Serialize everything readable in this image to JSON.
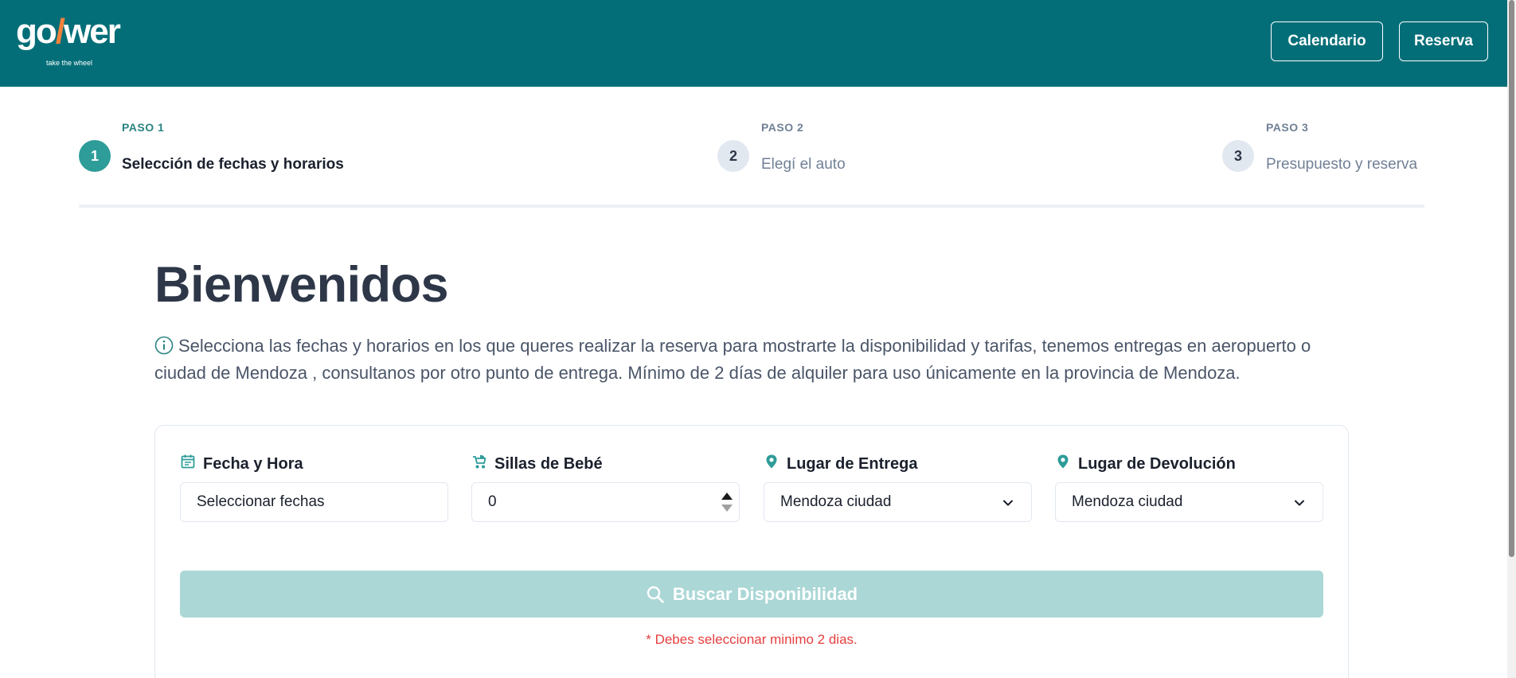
{
  "header": {
    "logo_text_a": "go",
    "logo_text_slash": "/",
    "logo_text_b": "wer",
    "logo_tagline": "take the wheel",
    "nav_calendar": "Calendario",
    "nav_reserve": "Reserva",
    "colors": {
      "bar": "#036e78",
      "accent": "#f0823c"
    }
  },
  "stepper": {
    "steps": [
      {
        "number": "1",
        "kicker": "PASO 1",
        "title": "Selección de fechas y horarios",
        "active": true
      },
      {
        "number": "2",
        "kicker": "PASO 2",
        "title": "Elegí el auto",
        "active": false
      },
      {
        "number": "3",
        "kicker": "PASO 3",
        "title": "Presupuesto y reserva",
        "active": false
      }
    ]
  },
  "main": {
    "title": "Bienvenidos",
    "info_icon": "info-icon",
    "info_text": "Selecciona las fechas y horarios en los que queres realizar la reserva para mostrarte la disponibilidad y tarifas, tenemos entregas en aeropuerto o ciudad de Mendoza , consultanos por otro punto de entrega. Mínimo de 2 días de alquiler para uso únicamente en la provincia de Mendoza."
  },
  "form": {
    "date": {
      "label": "Fecha y Hora",
      "icon": "calendar-icon",
      "value": "Seleccionar fechas"
    },
    "seats": {
      "label": "Sillas de Bebé",
      "icon": "stroller-icon",
      "value": "0"
    },
    "pickup": {
      "label": "Lugar de Entrega",
      "icon": "location-pin-icon",
      "value": "Mendoza ciudad"
    },
    "dropoff": {
      "label": "Lugar de Devolución",
      "icon": "location-pin-icon",
      "value": "Mendoza ciudad"
    },
    "search_label": "Buscar Disponibilidad",
    "error_text": "* Debes seleccionar minimo 2 dias.",
    "colors": {
      "primary": "#2e9c99",
      "disabled": "#abd7d6",
      "error": "#e53e3e"
    }
  }
}
